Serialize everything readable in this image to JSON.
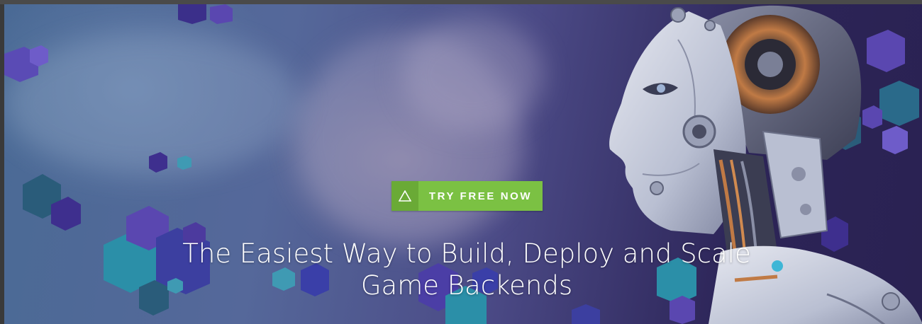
{
  "hero": {
    "cta_label": "TRY FREE NOW",
    "cta_icon": "triangle-icon",
    "headline_line1": "The Easiest Way to Build, Deploy and Scale",
    "headline_line2": "Game Backends"
  },
  "colors": {
    "cta_green": "#7bc143",
    "cta_icon_green": "#6aaa36",
    "sky_blue": "#4a6a95",
    "deep_purple": "#2c2457",
    "text": "#ffffff"
  }
}
